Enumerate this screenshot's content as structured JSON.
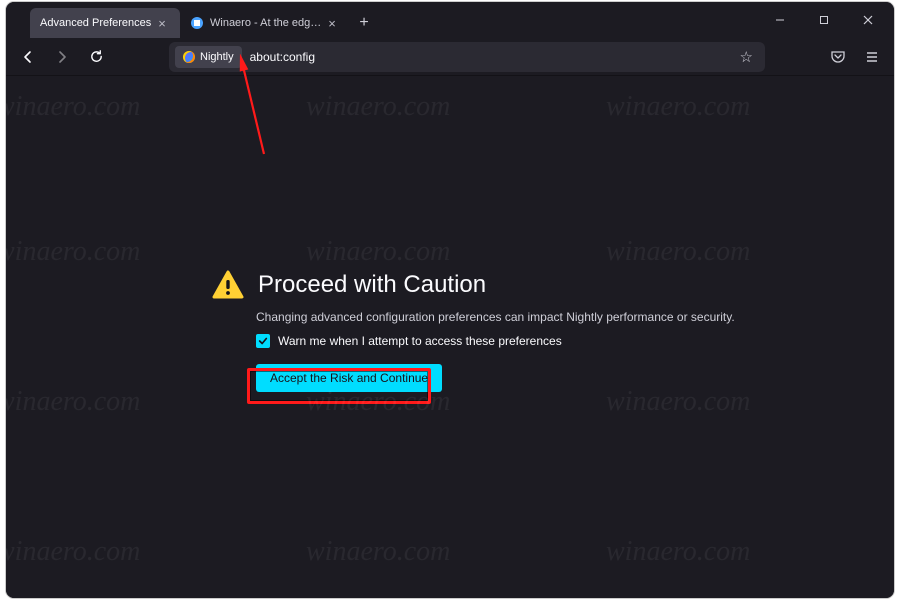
{
  "window": {
    "tabs": [
      {
        "label": "Advanced Preferences",
        "active": true
      },
      {
        "label": "Winaero - At the edge of tweaking",
        "active": false
      }
    ],
    "new_tab_tooltip": "New Tab"
  },
  "toolbar": {
    "back_tooltip": "Back",
    "forward_tooltip": "Forward",
    "reload_tooltip": "Reload",
    "identity_label": "Nightly",
    "url": "about:config",
    "bookmark_tooltip": "Bookmark this page",
    "pocket_tooltip": "Save to Pocket",
    "menu_tooltip": "Open application menu"
  },
  "win_controls": {
    "minimize": "Minimize",
    "maximize": "Maximize",
    "close": "Close"
  },
  "warning": {
    "title": "Proceed with Caution",
    "body": "Changing advanced configuration preferences can impact Nightly performance or security.",
    "checkbox_label": "Warn me when I attempt to access these preferences",
    "accept_label": "Accept the Risk and Continue"
  },
  "watermark": "winaero.com"
}
